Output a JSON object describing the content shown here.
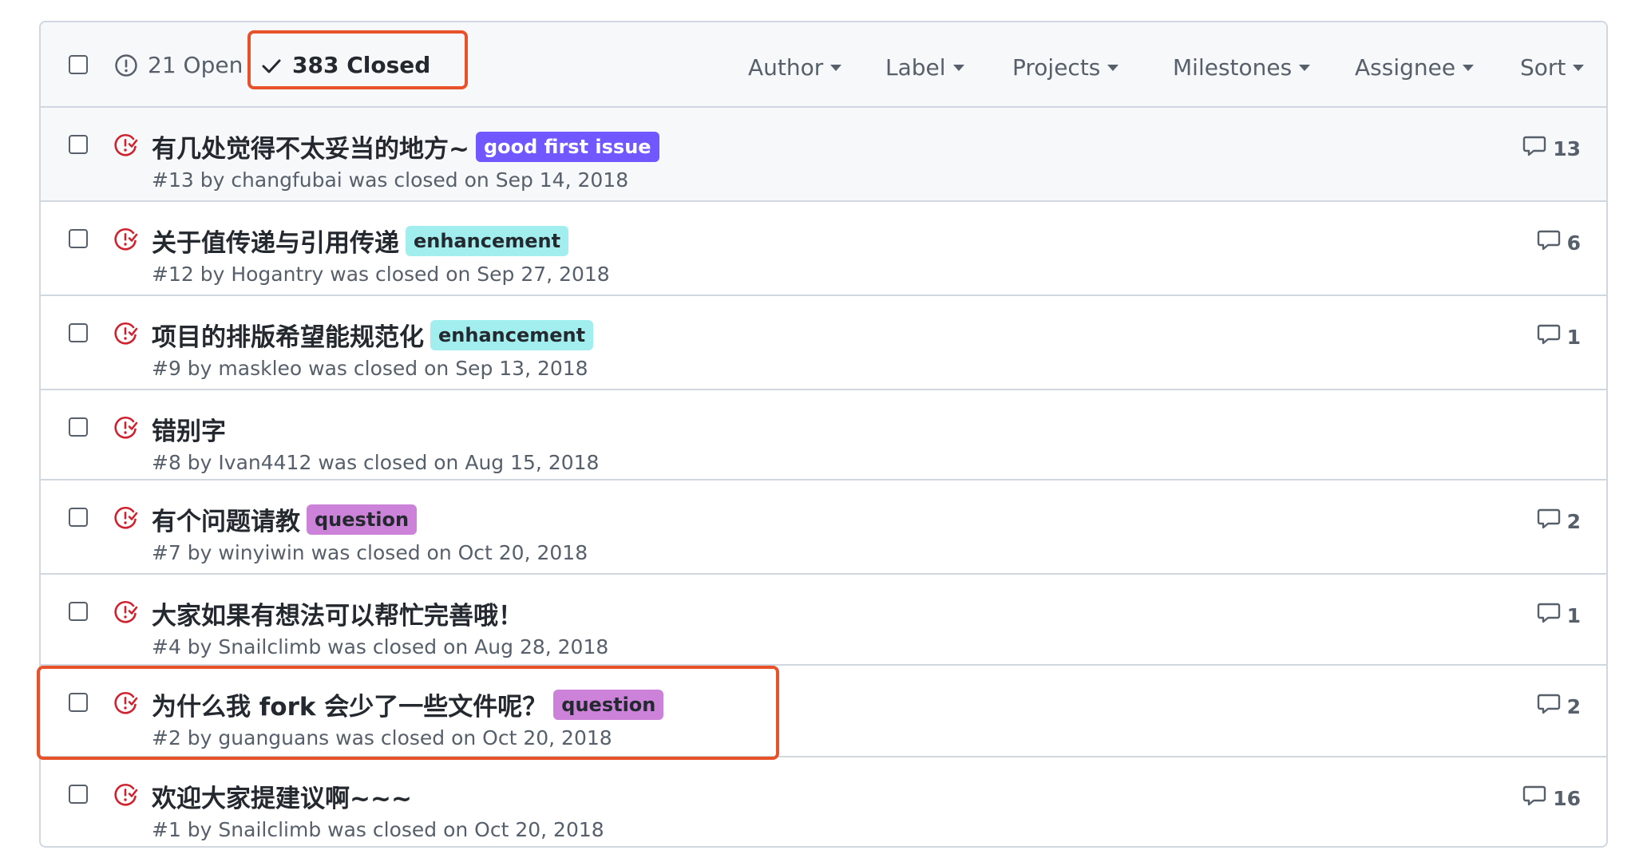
{
  "header": {
    "open_count": "21 Open",
    "closed_count": "383 Closed",
    "filters": [
      "Author",
      "Label",
      "Projects",
      "Milestones",
      "Assignee",
      "Sort"
    ]
  },
  "issues": [
    {
      "title": "有几处觉得不太妥当的地方~",
      "label": "good first issue",
      "label_bg": "#7057ff",
      "label_fg": "#ffffff",
      "meta": "#13 by changfubai was closed on Sep 14, 2018",
      "comments": "13",
      "hovered": true
    },
    {
      "title": "关于值传递与引用传递",
      "label": "enhancement",
      "label_bg": "#a2eeef",
      "label_fg": "#24292f",
      "meta": "#12 by Hogantry was closed on Sep 27, 2018",
      "comments": "6"
    },
    {
      "title": "项目的排版希望能规范化",
      "label": "enhancement",
      "label_bg": "#a2eeef",
      "label_fg": "#24292f",
      "meta": "#9 by maskleo was closed on Sep 13, 2018",
      "comments": "1"
    },
    {
      "title": "错别字",
      "label": "",
      "label_bg": "",
      "label_fg": "",
      "meta": "#8 by Ivan4412 was closed on Aug 15, 2018",
      "comments": ""
    },
    {
      "title": "有个问题请教",
      "label": "question",
      "label_bg": "#cc82d8",
      "label_fg": "#24292f",
      "meta": "#7 by winyiwin was closed on Oct 20, 2018",
      "comments": "2"
    },
    {
      "title": "大家如果有想法可以帮忙完善哦！",
      "label": "",
      "label_bg": "",
      "label_fg": "",
      "meta": "#4 by Snailclimb was closed on Aug 28, 2018",
      "comments": "1"
    },
    {
      "title": "为什么我 fork 会少了一些文件呢？",
      "label": "question",
      "label_bg": "#cc82d8",
      "label_fg": "#24292f",
      "meta": "#2 by guanguans was closed on Oct 20, 2018",
      "comments": "2"
    },
    {
      "title": "欢迎大家提建议啊~~~",
      "label": "",
      "label_bg": "",
      "label_fg": "",
      "meta": "#1 by Snailclimb was closed on Oct 20, 2018",
      "comments": "16"
    }
  ],
  "colors": {
    "closed_icon": "#cf222e",
    "highlight": "#e8522a"
  },
  "icons": {
    "open": "issue-opened-icon",
    "closed_tab": "check-icon",
    "issue_state": "issue-closed-icon",
    "comments": "comment-icon"
  }
}
